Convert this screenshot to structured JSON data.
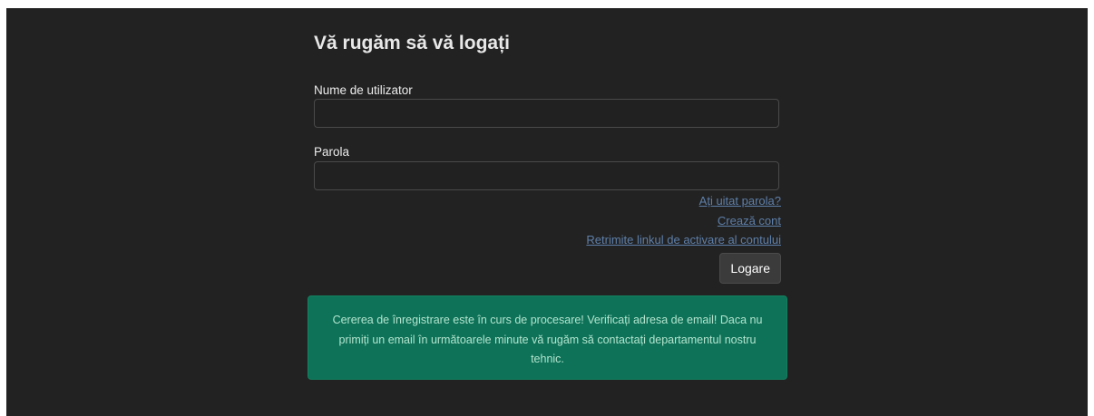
{
  "login": {
    "title": "Vă rugăm să vă logați",
    "username": {
      "label": "Nume de utilizator",
      "value": "",
      "placeholder": ""
    },
    "password": {
      "label": "Parola",
      "value": "",
      "placeholder": ""
    },
    "links": {
      "forgot_password": "Ați uitat parola?",
      "create_account": "Crează cont",
      "resend_activation": "Retrimite linkul de activare al contului"
    },
    "submit_label": "Logare"
  },
  "alert": {
    "message": "Cererea de înregistrare este în curs de procesare! Verificați adresa de email! Daca nu primiți un email în următoarele minute vă rugăm să contactați departamentul nostru tehnic."
  },
  "colors": {
    "background": "#222222",
    "link": "#5e7fa9",
    "alert_background": "#0d7258",
    "alert_text": "#b3e4ce",
    "button_background": "#3b3b3b"
  }
}
